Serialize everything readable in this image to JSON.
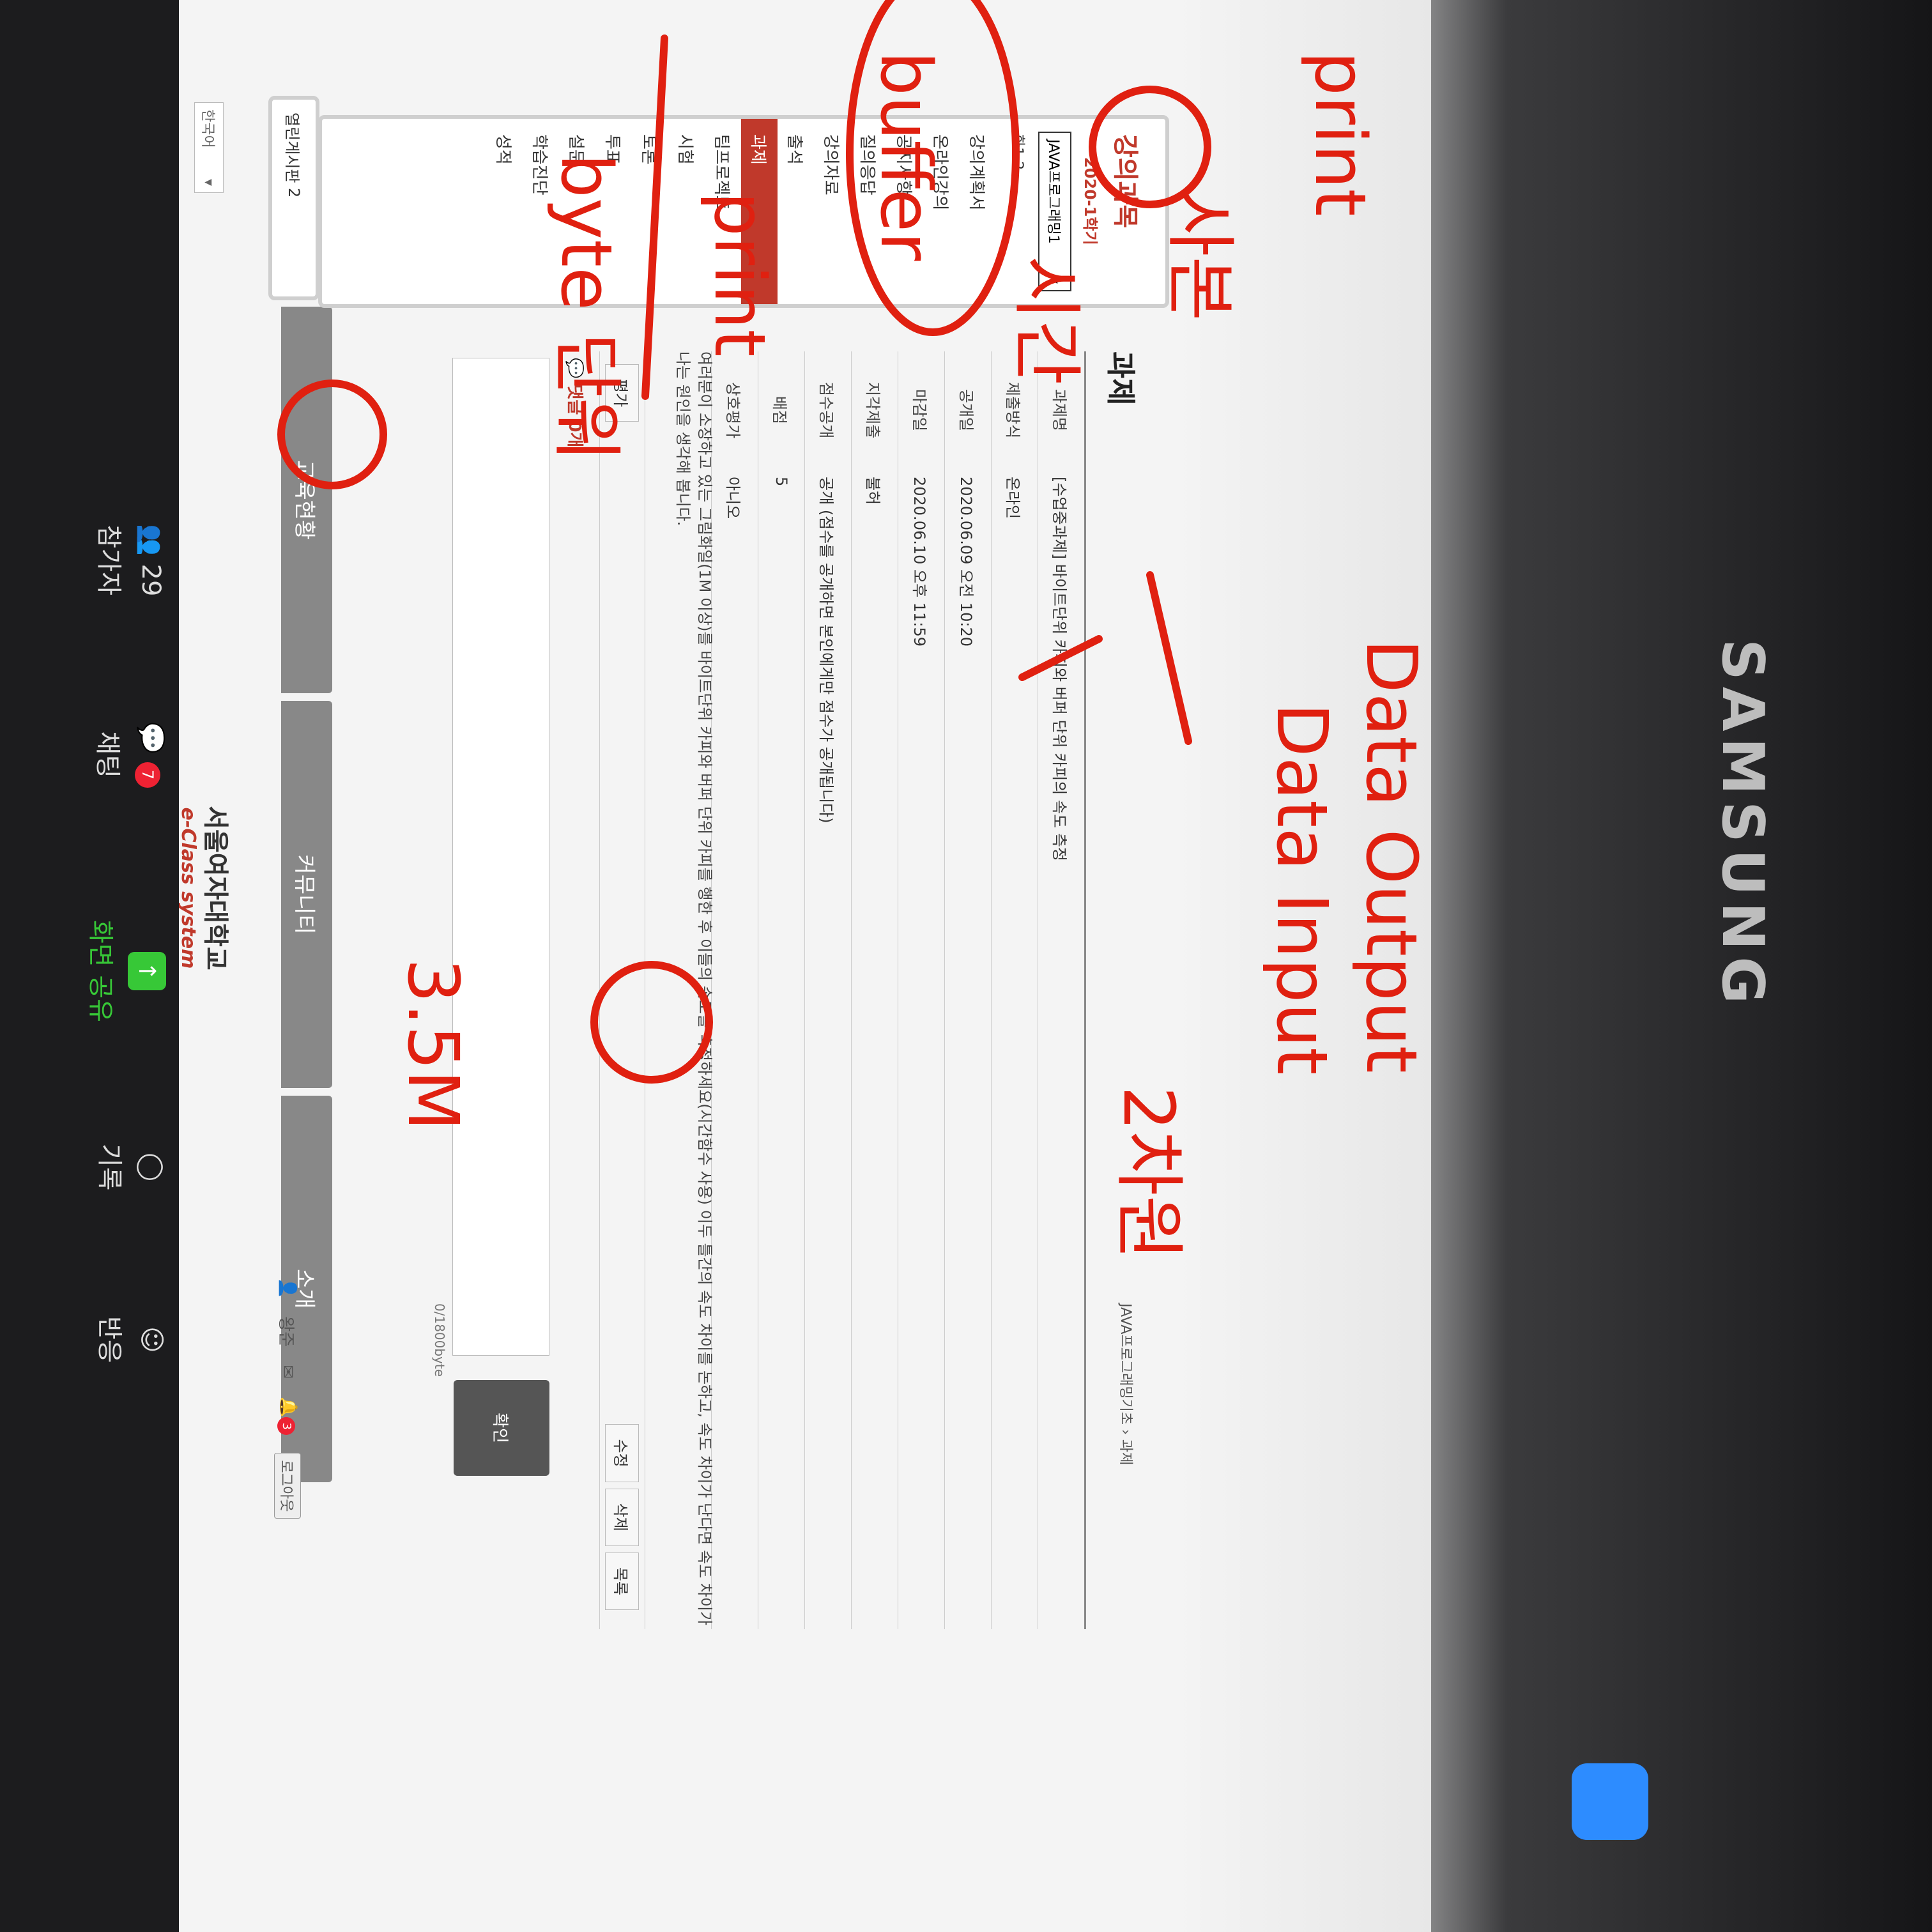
{
  "site": {
    "lang_select": "한국어",
    "brand_ko": "서울여자대학교",
    "brand_en": "e-Class system",
    "nav": [
      "교육현황",
      "커뮤니티",
      "소개"
    ],
    "topbar": {
      "user": "왕준",
      "notif_count": "3",
      "logout": "로그아웃"
    }
  },
  "sidebar": {
    "title": "강의과목",
    "semester": "2020-1학기",
    "course": "JAVA프로그래밍1",
    "class_no": "화1-2",
    "items": [
      "강의계획서",
      "온라인강의",
      "공지사항",
      "질의응답",
      "강의자료",
      "출석",
      "과제",
      "팀프로젝트",
      "시험",
      "토론",
      "투표",
      "설문",
      "학습진단",
      "성적"
    ],
    "active_index": 6,
    "board": "열린게시판",
    "board_count": "2"
  },
  "main": {
    "breadcrumb": "JAVA프로그래밍기초 › 과제",
    "title": "과제",
    "fields": [
      {
        "k": "과제명",
        "v": "[수업중과제] 바이트단위 카피와 버퍼 단위 카피의 속도 측정"
      },
      {
        "k": "제출방식",
        "v": "온라인"
      },
      {
        "k": "공개일",
        "v": "2020.06.09 오전 10:20"
      },
      {
        "k": "마감일",
        "v": "2020.06.10 오후 11:59"
      },
      {
        "k": "지각제출",
        "v": "불허"
      },
      {
        "k": "점수공개",
        "v": "공개 (점수를 공개하면 본인에게만 점수가 공개됩니다)"
      },
      {
        "k": "배점",
        "v": "5"
      },
      {
        "k": "상호평가",
        "v": "아니오"
      }
    ],
    "description": "여러분이 소장하고 있는 그림화일(1M 이상)를 바이트단위 카피와 버퍼 단위 카피를 행한 후 이들의 속도를 측정하세요(시간함수 사용) 이두 틀간의 속도 차이를 논하고, 속도 차이가 난다면 속도 차이가 나는 원인을 생각해 봅니다.",
    "eval_btn": "평가",
    "actions": [
      "수정",
      "삭제",
      "목록"
    ],
    "reply_label": "댓글 0개",
    "byte_count": "0/1800byte",
    "confirm": "확인"
  },
  "zoom": {
    "participants_count": "29",
    "participants": "참가자",
    "chat_badge": "7",
    "chat": "채팅",
    "share": "화면 공유",
    "record": "기록",
    "react": "반응"
  },
  "bezel": {
    "brand": "SAMSUNG"
  },
  "handwriting": [
    "3.5M",
    "byte 단위",
    "print",
    "buffer",
    "시간",
    "사본",
    "print",
    "2차원",
    "Data Input",
    "Data Output"
  ]
}
